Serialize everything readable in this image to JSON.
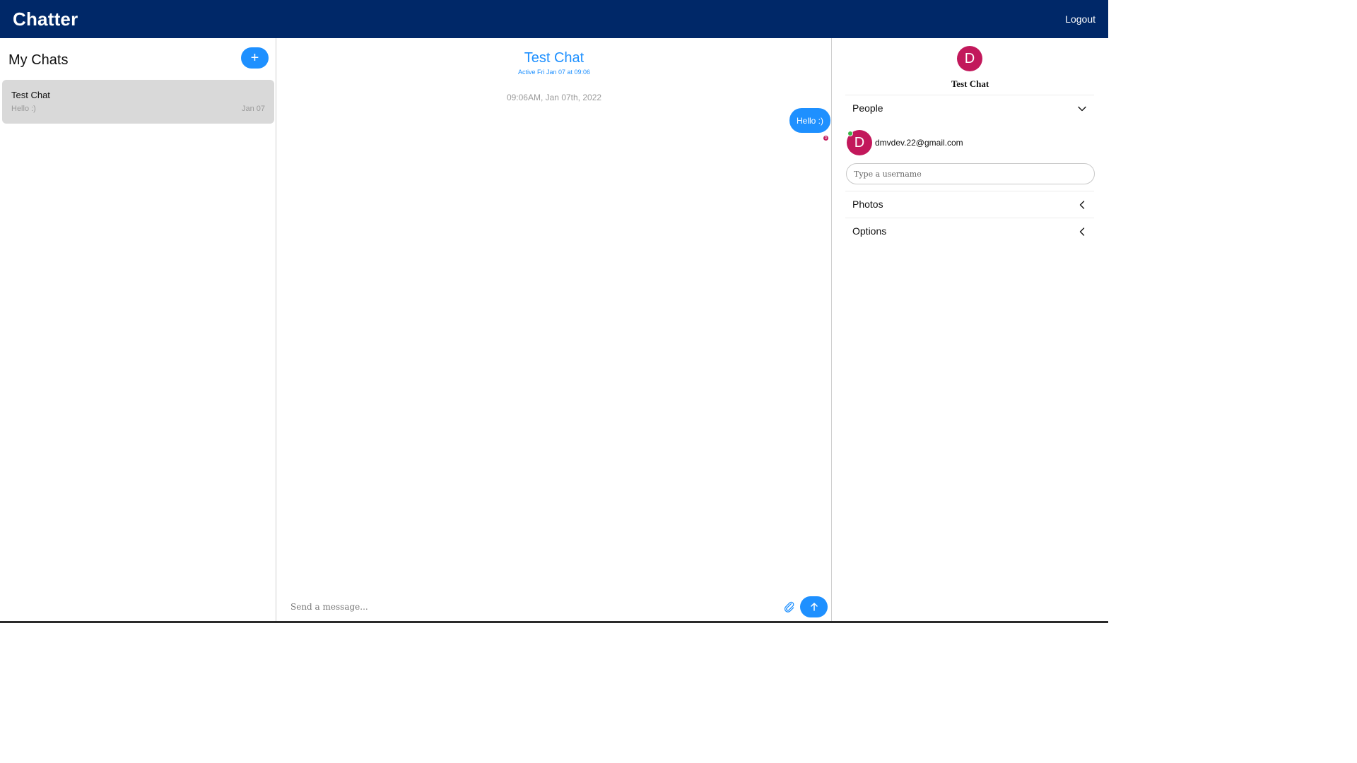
{
  "header": {
    "brand": "Chatter",
    "logout_label": "Logout"
  },
  "sidebar": {
    "title": "My Chats",
    "new_chat_symbol": "+",
    "chats": [
      {
        "title": "Test Chat",
        "preview": "Hello :)",
        "date": "Jan 07"
      }
    ]
  },
  "conversation": {
    "title": "Test Chat",
    "subtitle": "Active Fri Jan 07 at 09:06",
    "timestamp": "09:06AM, Jan 07th, 2022",
    "messages": [
      {
        "text": "Hello :)",
        "read_badge": "D"
      }
    ],
    "composer_placeholder": "Send a message...",
    "attach_icon": "paperclip-icon",
    "send_icon": "arrow-up-icon"
  },
  "details": {
    "avatar_letter": "D",
    "chat_name": "Test Chat",
    "people_label": "People",
    "people": [
      {
        "avatar_letter": "D",
        "email": "dmvdev.22@gmail.com",
        "online": true
      }
    ],
    "username_placeholder": "Type a username",
    "photos_label": "Photos",
    "options_label": "Options"
  },
  "colors": {
    "header_bg": "#002868",
    "accent": "#1e90ff",
    "avatar": "#c2185b",
    "online": "#3cb54a",
    "selected_chat_bg": "#d9d9d9"
  }
}
